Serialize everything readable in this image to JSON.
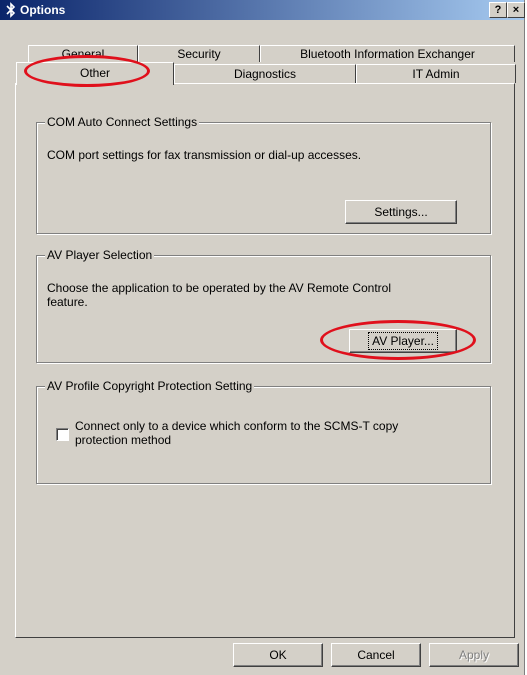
{
  "window": {
    "title": "Options",
    "help_label": "?",
    "close_label": "×"
  },
  "tabs": {
    "row_back": [
      "General",
      "Security",
      "Bluetooth Information Exchanger"
    ],
    "row_front": [
      "Other",
      "Diagnostics",
      "IT Admin"
    ],
    "active": "Other"
  },
  "com_group": {
    "title": "COM Auto Connect Settings",
    "description": "COM port settings for fax transmission or dial-up accesses.",
    "button_label": "Settings..."
  },
  "av_group": {
    "title": "AV Player Selection",
    "description_line1": "Choose the application to be operated by the AV Remote Control",
    "description_line2": "feature.",
    "button_label": "AV Player..."
  },
  "copyright_group": {
    "title": "AV Profile Copyright Protection Setting",
    "checkbox_line1": "Connect only to a device which conform to the SCMS-T copy",
    "checkbox_line2": "protection method",
    "checked": false
  },
  "footer": {
    "ok_label": "OK",
    "cancel_label": "Cancel",
    "apply_label": "Apply"
  },
  "colors": {
    "annotation": "#e0101c",
    "titlebar_start": "#0a246a",
    "titlebar_end": "#a6caf0",
    "dialog_face": "#d4d0c8"
  }
}
